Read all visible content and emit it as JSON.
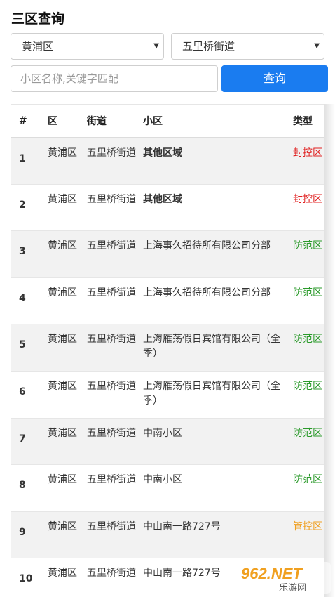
{
  "page": {
    "title": "三区查询"
  },
  "filters": {
    "district": "黄浦区",
    "street": "五里桥街道",
    "search_placeholder": "小区名称,关键字匹配",
    "search_button": "查询"
  },
  "table": {
    "headers": [
      "#",
      "区",
      "街道",
      "小区",
      "类型"
    ],
    "rows": [
      {
        "num": "1",
        "district": "黄浦区",
        "street": "五里桥街道",
        "community": "其他区域",
        "type": "封控区",
        "type_class": "type-red",
        "bold": true
      },
      {
        "num": "2",
        "district": "黄浦区",
        "street": "五里桥街道",
        "community": "其他区域",
        "type": "封控区",
        "type_class": "type-red",
        "bold": true
      },
      {
        "num": "3",
        "district": "黄浦区",
        "street": "五里桥街道",
        "community": "上海事久招待所有限公司分部",
        "type": "防范区",
        "type_class": "type-green",
        "bold": false
      },
      {
        "num": "4",
        "district": "黄浦区",
        "street": "五里桥街道",
        "community": "上海事久招待所有限公司分部",
        "type": "防范区",
        "type_class": "type-green",
        "bold": false
      },
      {
        "num": "5",
        "district": "黄浦区",
        "street": "五里桥街道",
        "community": "上海雁荡假日宾馆有限公司（全季）",
        "type": "防范区",
        "type_class": "type-green",
        "bold": false
      },
      {
        "num": "6",
        "district": "黄浦区",
        "street": "五里桥街道",
        "community": "上海雁荡假日宾馆有限公司（全季）",
        "type": "防范区",
        "type_class": "type-green",
        "bold": false
      },
      {
        "num": "7",
        "district": "黄浦区",
        "street": "五里桥街道",
        "community": "中南小区",
        "type": "防范区",
        "type_class": "type-green",
        "bold": false
      },
      {
        "num": "8",
        "district": "黄浦区",
        "street": "五里桥街道",
        "community": "中南小区",
        "type": "防范区",
        "type_class": "type-green",
        "bold": false
      },
      {
        "num": "9",
        "district": "黄浦区",
        "street": "五里桥街道",
        "community": "中山南一路727号",
        "type": "管控区",
        "type_class": "type-orange",
        "bold": false
      },
      {
        "num": "10",
        "district": "黄浦区",
        "street": "五里桥街道",
        "community": "中山南一路727号",
        "type": "",
        "type_class": "type-green",
        "bold": false
      }
    ]
  },
  "watermark": {
    "text": "962.NET",
    "subtext": "乐游网"
  },
  "colors": {
    "accent": "#1a7cf0",
    "red": "#e02020",
    "green": "#2a9a2a",
    "orange": "#f0a020"
  }
}
